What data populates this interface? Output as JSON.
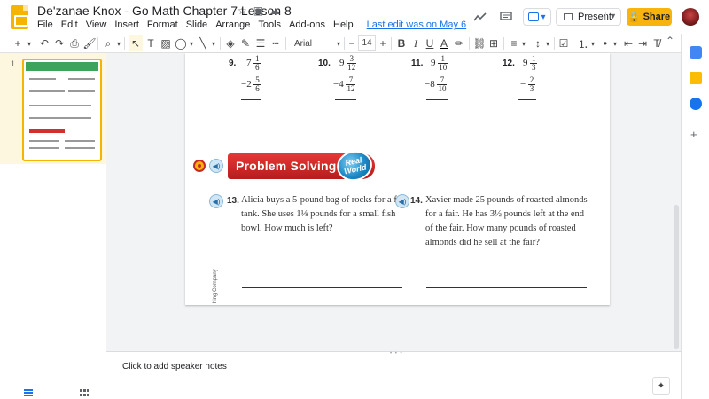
{
  "app": {
    "doc_title": "De'zanae Knox - Go Math Chapter 7 Lesson 8",
    "menu": [
      "File",
      "Edit",
      "View",
      "Insert",
      "Format",
      "Slide",
      "Arrange",
      "Tools",
      "Add-ons",
      "Help"
    ],
    "last_edit": "Last edit was on May 6",
    "present_label": "Present",
    "share_label": "Share",
    "accent_color": "#f8b40c"
  },
  "toolbar": {
    "font_name": "Arial",
    "font_size": "14"
  },
  "filmstrip": {
    "slide_number": "1"
  },
  "slide": {
    "problems": [
      {
        "num": "9.",
        "top_whole": "7",
        "top_n": "1",
        "top_d": "6",
        "bot_whole": "−2",
        "bot_n": "5",
        "bot_d": "6"
      },
      {
        "num": "10.",
        "top_whole": "9",
        "top_n": "3",
        "top_d": "12",
        "bot_whole": "−4",
        "bot_n": "7",
        "bot_d": "12"
      },
      {
        "num": "11.",
        "top_whole": "9",
        "top_n": "1",
        "top_d": "10",
        "bot_whole": "−8",
        "bot_n": "7",
        "bot_d": "10"
      },
      {
        "num": "12.",
        "top_whole": "9",
        "top_n": "1",
        "top_d": "3",
        "bot_whole": "−",
        "bot_n": "2",
        "bot_d": "3"
      }
    ],
    "banner_title": "Problem Solving",
    "badge_top": "Real",
    "badge_bottom": "World",
    "p13_num": "13.",
    "p13_line1": "Alicia buys a 5-pound bag of rocks for a fish",
    "p13_line2": "tank. She uses 1⅛ pounds for a small fish",
    "p13_line3": "bowl. How much is left?",
    "p14_num": "14.",
    "p14_line1": "Xavier made 25 pounds of roasted almonds",
    "p14_line2": "for a fair. He has 3½ pounds left at the end",
    "p14_line3": "of the fair. How many pounds of roasted",
    "p14_line4": "almonds did he sell at  the fair?",
    "side_text": "hing Company"
  },
  "notes": {
    "placeholder": "Click to add speaker notes"
  }
}
